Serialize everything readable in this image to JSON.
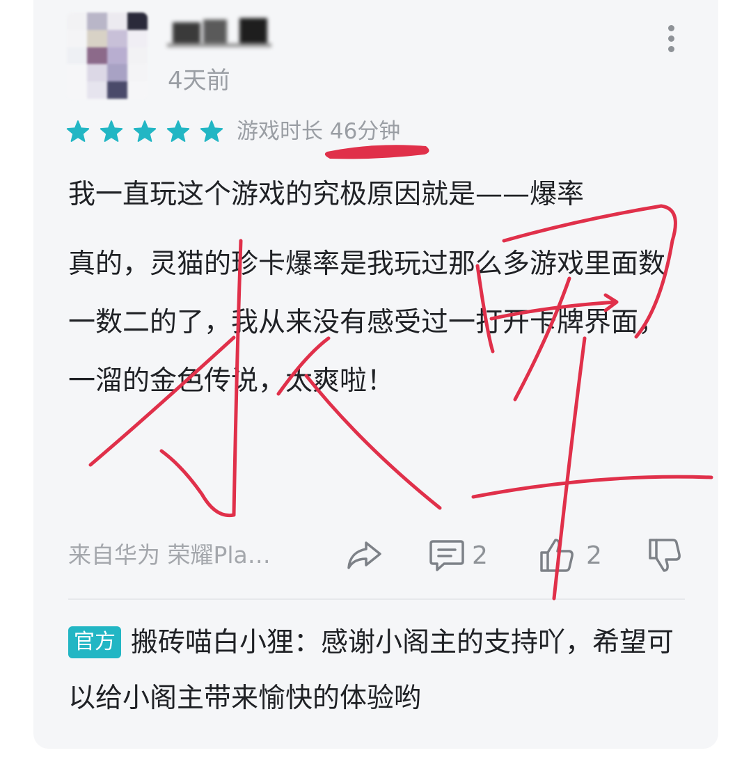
{
  "review": {
    "time_ago": "4天前",
    "rating": 5,
    "playtime": "游戏时长 46分钟",
    "content": [
      "我一直玩这个游戏的究极原因就是——爆率",
      "真的，灵猫的珍卡爆率是我玩过那么多游戏里面数一数二的了，我从来没有感受过一打开卡牌界面，一溜的金色传说，太爽啦！"
    ],
    "source": "来自华为 荣耀Pla…",
    "reply_count": "2",
    "like_count": "2"
  },
  "official_reply": {
    "badge": "官方",
    "text": "搬砖喵白小狸：感谢小阁主的支持吖，希望可以给小阁主带来愉快的体验哟"
  },
  "colors": {
    "star": "#22b6c4",
    "badge": "#22b6c4",
    "ink": "#e0304a",
    "card_bg": "#f5f6f8"
  },
  "icons": [
    "more-vertical-icon",
    "star-icon",
    "share-icon",
    "comment-icon",
    "thumbs-up-icon",
    "thumbs-down-icon"
  ]
}
